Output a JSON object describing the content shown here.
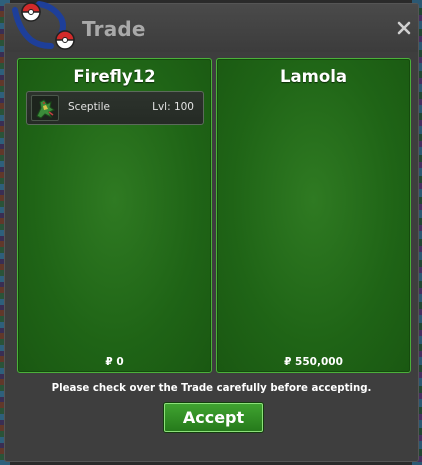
{
  "window": {
    "title": "Trade",
    "close_icon": "close-x-icon",
    "logo_icon": "pokeball-swirl-logo"
  },
  "panels": [
    {
      "player": "Firefly12",
      "pokemon": [
        {
          "icon": "sceptile-sprite-icon",
          "name": "Sceptile",
          "level": "Lvl: 100"
        }
      ],
      "money": "₽ 0"
    },
    {
      "player": "Lamola",
      "pokemon": [],
      "money": "₽ 550,000"
    }
  ],
  "notice": "Please check over the Trade carefully before accepting.",
  "accept_button": "Accept",
  "colors": {
    "panel_green": "#1f6416",
    "panel_border": "#4bb03a",
    "button_green": "#3fa330",
    "window_bg": "#3e3e3e",
    "title_text": "#a9a9a9"
  }
}
